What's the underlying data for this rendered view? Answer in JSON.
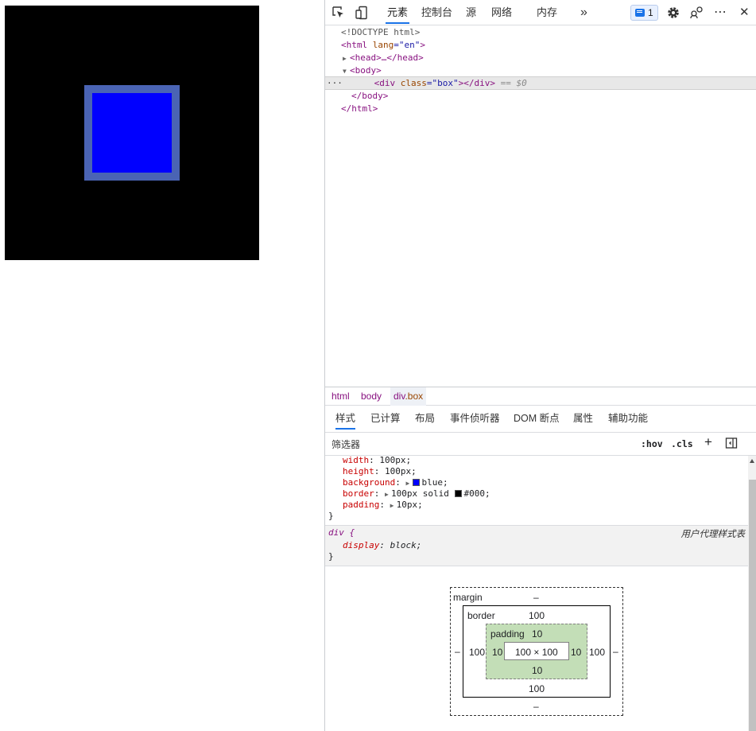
{
  "toolbar": {
    "tabs": [
      "元素",
      "控制台",
      "源",
      "网络",
      "内存"
    ],
    "more_tabs": "»",
    "issues_count": "1",
    "more_menu": "⋯",
    "close": "✕"
  },
  "dom": {
    "doctype": "<!DOCTYPE html>",
    "html_open_tag": "<html",
    "html_attr": "lang",
    "html_attr_val": "\"en\"",
    "head": "<head>…</head>",
    "body_open": "<body>",
    "div_open": "<div",
    "div_attr": "class",
    "div_attr_val": "\"box\"",
    "div_close": "></div>",
    "eq0": "== $0",
    "body_close": "</body>",
    "html_close": "</html>",
    "ellipsis": "···"
  },
  "breadcrumb": [
    "html",
    "body",
    "div",
    ".box"
  ],
  "panel_tabs": [
    "样式",
    "已计算",
    "布局",
    "事件侦听器",
    "DOM 断点",
    "属性",
    "辅助功能"
  ],
  "filter": {
    "placeholder": "筛选器",
    "hov": ":hov",
    "cls": ".cls",
    "plus": "+"
  },
  "styles": {
    "rule1": [
      {
        "prop": "width",
        "value": "100px;"
      },
      {
        "prop": "height",
        "value": "100px;"
      },
      {
        "prop": "background",
        "value": "blue;",
        "swatch": "#0000ff"
      },
      {
        "prop": "border",
        "value": "100px solid",
        "value2": "#000;",
        "swatch": "#000000"
      },
      {
        "prop": "padding",
        "value": "10px;"
      }
    ],
    "close_brace": "}",
    "ua_selector": "div {",
    "ua_label": "用户代理样式表",
    "ua_prop": "display",
    "ua_value": "block;"
  },
  "box_model": {
    "margin_label": "margin",
    "margin_top": "–",
    "margin_bottom": "–",
    "margin_left": "–",
    "margin_right": "–",
    "border_label": "border",
    "border_top": "100",
    "border_bottom": "100",
    "border_left": "100",
    "border_right": "100",
    "padding_label": "padding",
    "padding_top": "10",
    "padding_bottom": "10",
    "padding_left": "10",
    "padding_right": "10",
    "content": "100 × 100"
  },
  "colors": {
    "accent": "#1a73e8",
    "preview_box_border": "#4a64b4",
    "preview_box_bg": "#0000ff",
    "padding_bg": "#c3deb7"
  }
}
